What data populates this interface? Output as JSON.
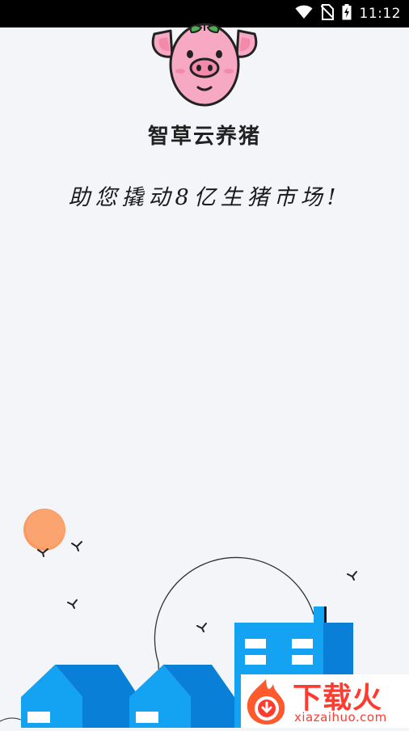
{
  "status_bar": {
    "time": "11:12",
    "icons": [
      "wifi-icon",
      "no-sim-icon",
      "battery-charging-icon"
    ]
  },
  "app": {
    "logo": "pig-logo",
    "title": "智草云养猪",
    "slogan": "助您撬动8亿生猪市场!"
  },
  "watermark": {
    "title": "下载火",
    "url": "xiazaihuo.com",
    "icon": "flame-logo-icon"
  },
  "colors": {
    "background": "#f4f5f9",
    "building_blue": "#0a7fd8",
    "building_light": "#14a3f2",
    "sun": "#f99b5e",
    "pig_pink": "#f7a9c3",
    "watermark_red": "#ff3b30"
  }
}
